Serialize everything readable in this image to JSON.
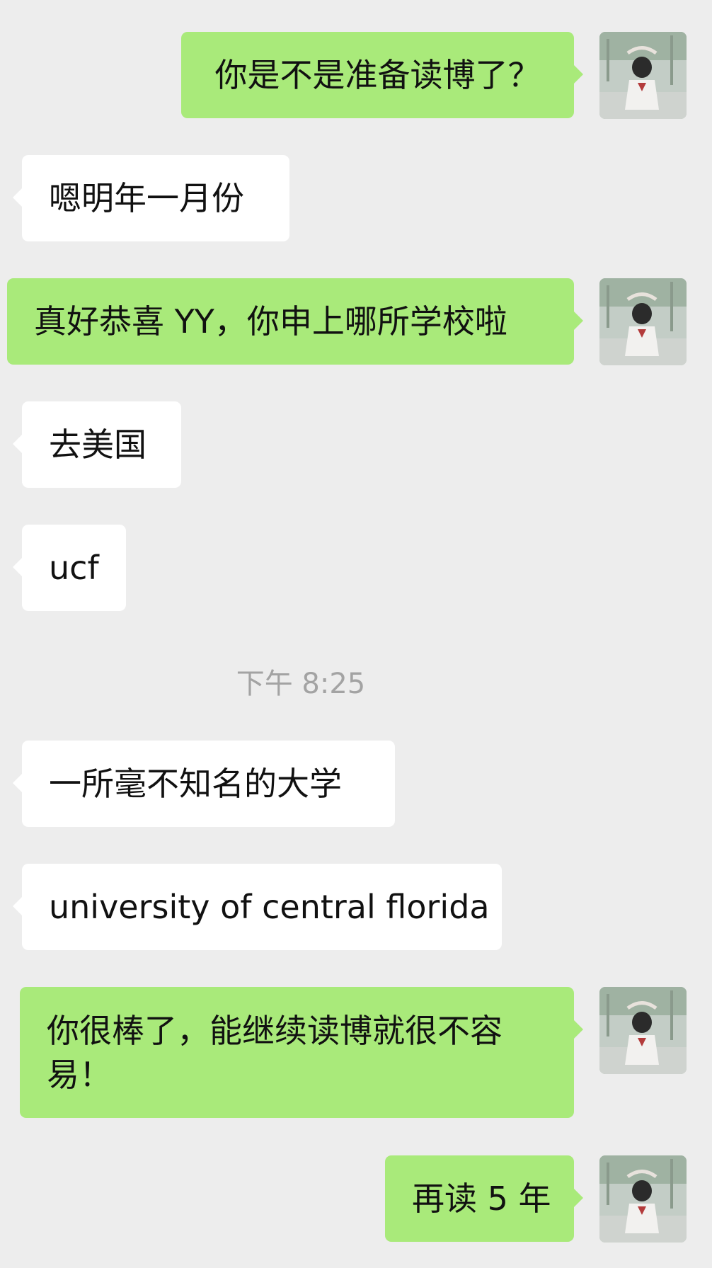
{
  "messages": [
    {
      "side": "me",
      "text": "你是不是准备读博了？"
    },
    {
      "side": "them",
      "text": "嗯明年一月份"
    },
    {
      "side": "me",
      "text": "真好恭喜 YY，你申上哪所学校啦"
    },
    {
      "side": "them",
      "text": "去美国"
    },
    {
      "side": "them",
      "text": "ucf"
    },
    {
      "side": "time",
      "text": "下午 8:25"
    },
    {
      "side": "them",
      "text": "一所毫不知名的大学"
    },
    {
      "side": "them",
      "text": "university of central florida"
    },
    {
      "side": "me",
      "text": "你很棒了，能继续读博就很不容易！"
    },
    {
      "side": "me",
      "text": "再读 5 年"
    }
  ],
  "colors": {
    "background": "#ededed",
    "my_bubble": "#a9ea7a",
    "their_bubble": "#ffffff",
    "timestamp": "#a3a3a3"
  },
  "icons": {
    "avatar": "user-avatar-photo"
  }
}
